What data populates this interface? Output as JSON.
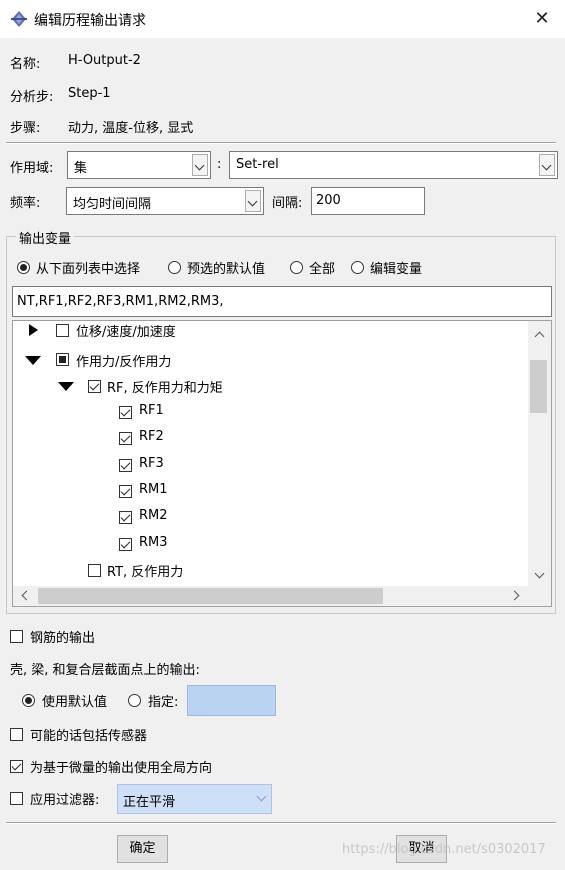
{
  "window": {
    "title": "编辑历程输出请求",
    "close_glyph": "✕"
  },
  "info": {
    "name_label": "名称:",
    "name_value": "H-Output-2",
    "step_label": "分析步:",
    "step_value": "Step-1",
    "procedure_label": "步骤:",
    "procedure_value": "动力, 温度-位移, 显式"
  },
  "domain": {
    "label": "作用域:",
    "type_value": "集",
    "separator": ":",
    "set_value": "Set-rel"
  },
  "frequency": {
    "label": "频率:",
    "value": "均匀时间间隔",
    "interval_label": "间隔:",
    "interval_value": "200"
  },
  "output_vars": {
    "group_title": "输出变量",
    "radios": [
      {
        "label": "从下面列表中选择",
        "selected": true
      },
      {
        "label": "预选的默认值",
        "selected": false
      },
      {
        "label": "全部",
        "selected": false
      },
      {
        "label": "编辑变量",
        "selected": false
      }
    ],
    "selected_text": "NT,RF1,RF2,RF3,RM1,RM2,RM3,",
    "tree": [
      {
        "label": "位移/速度/加速度",
        "expander": "collapsed",
        "state": "unchecked"
      },
      {
        "label": "作用力/反作用力",
        "expander": "expanded",
        "state": "partial"
      },
      {
        "label": "RF, 反作用力和力矩",
        "expander": "expanded",
        "state": "checked"
      },
      {
        "label": "RF1",
        "state": "checked"
      },
      {
        "label": "RF2",
        "state": "checked"
      },
      {
        "label": "RF3",
        "state": "checked"
      },
      {
        "label": "RM1",
        "state": "checked"
      },
      {
        "label": "RM2",
        "state": "checked"
      },
      {
        "label": "RM3",
        "state": "checked"
      },
      {
        "label": "RT, 反作用力",
        "state": "unchecked"
      }
    ]
  },
  "options": {
    "rebar_label": "钢筋的输出",
    "rebar_checked": false,
    "section_points_label": "壳, 梁, 和复合层截面点上的输出:",
    "use_default_label": "使用默认值",
    "specify_label": "指定:",
    "sensors_label": "可能的话包括传感器",
    "sensors_checked": false,
    "global_dir_label": "为基于微量的输出使用全局方向",
    "global_dir_checked": true,
    "filter_label": "应用过滤器:",
    "filter_checked": false,
    "filter_value": "正在平滑"
  },
  "buttons": {
    "ok": "确定",
    "cancel": "取消"
  },
  "watermark": "https://blog.csdn.net/s0302017",
  "colors": {
    "accent": "#b9d3f1",
    "window_bg": "#f0f0f0"
  }
}
